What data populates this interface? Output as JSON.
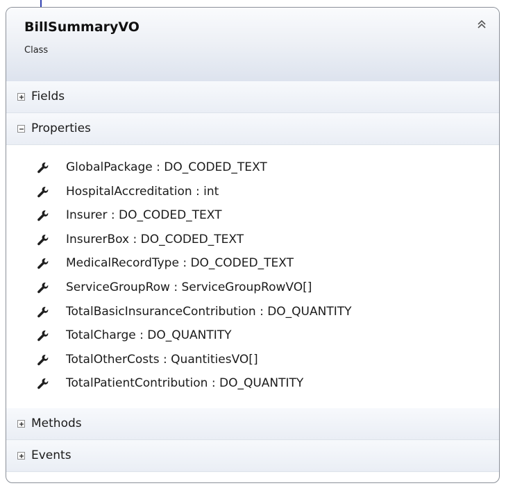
{
  "class_name": "BillSummaryVO",
  "class_kind": "Class",
  "sections": {
    "fields": {
      "label": "Fields",
      "expanded": false
    },
    "properties": {
      "label": "Properties",
      "expanded": true
    },
    "methods": {
      "label": "Methods",
      "expanded": false
    },
    "events": {
      "label": "Events",
      "expanded": false
    }
  },
  "properties": [
    {
      "text": "GlobalPackage : DO_CODED_TEXT",
      "icon": "wrench-icon"
    },
    {
      "text": "HospitalAccreditation : int",
      "icon": "wrench-icon"
    },
    {
      "text": "Insurer : DO_CODED_TEXT",
      "icon": "wrench-icon"
    },
    {
      "text": "InsurerBox : DO_CODED_TEXT",
      "icon": "wrench-icon"
    },
    {
      "text": "MedicalRecordType : DO_CODED_TEXT",
      "icon": "wrench-icon"
    },
    {
      "text": "ServiceGroupRow : ServiceGroupRowVO[]",
      "icon": "wrench-icon"
    },
    {
      "text": "TotalBasicInsuranceContribution : DO_QUANTITY",
      "icon": "wrench-icon"
    },
    {
      "text": "TotalCharge : DO_QUANTITY",
      "icon": "wrench-icon"
    },
    {
      "text": "TotalOtherCosts : QuantitiesVO[]",
      "icon": "wrench-icon"
    },
    {
      "text": "TotalPatientContribution : DO_QUANTITY",
      "icon": "wrench-icon"
    }
  ],
  "colors": {
    "connector": "#2f3fb0",
    "border": "#8a8f98",
    "header_gradient_bottom": "#dde3ee"
  }
}
